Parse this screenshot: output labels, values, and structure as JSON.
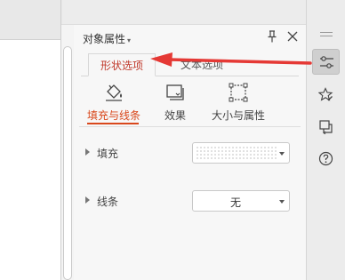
{
  "panel": {
    "title": "对象属性",
    "tabs": [
      {
        "label": "形状选项",
        "active": true
      },
      {
        "label": "文本选项",
        "active": false
      }
    ],
    "sub_tabs": [
      {
        "label": "填充与线条",
        "icon": "fill-bucket-icon",
        "active": true
      },
      {
        "label": "效果",
        "icon": "effects-icon",
        "active": false
      },
      {
        "label": "大小与属性",
        "icon": "size-properties-icon",
        "active": false
      }
    ],
    "fill": {
      "label": "填充",
      "value_pattern": "dotted"
    },
    "line": {
      "label": "线条",
      "value": "无"
    }
  },
  "right_bar": {
    "buttons": [
      {
        "icon": "properties-sliders-icon",
        "active": true
      },
      {
        "icon": "star-edit-icon",
        "active": false
      },
      {
        "icon": "layers-transfer-icon",
        "active": false
      },
      {
        "icon": "help-icon",
        "active": false
      }
    ]
  },
  "colors": {
    "accent_red": "#d9481c",
    "annotation_arrow": "#e53935"
  }
}
